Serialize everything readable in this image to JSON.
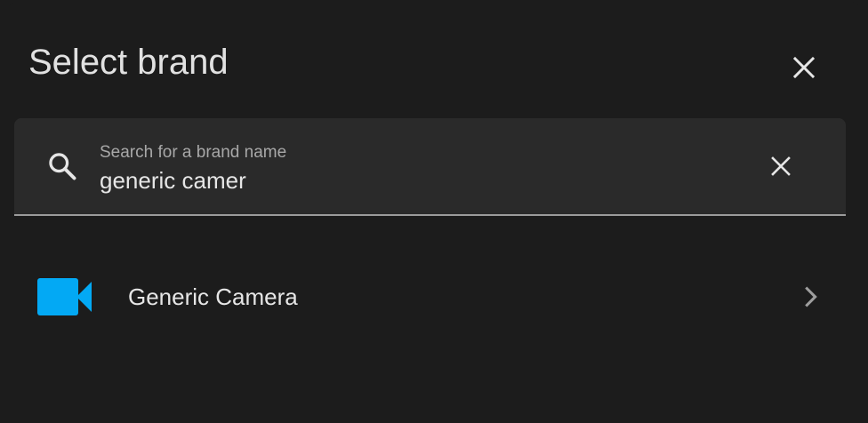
{
  "dialog": {
    "title": "Select brand",
    "close_icon": "close-icon"
  },
  "search": {
    "label": "Search for a brand name",
    "value": "generic camer",
    "search_icon": "search-icon",
    "clear_icon": "clear-icon"
  },
  "results": [
    {
      "label": "Generic Camera",
      "icon": "video-camera-icon",
      "icon_color": "#03a9f4",
      "chevron_icon": "chevron-right-icon"
    }
  ],
  "colors": {
    "background": "#1c1c1c",
    "field_background": "#2a2a2a",
    "accent": "#03a9f4",
    "text": "#e1e1e1"
  }
}
